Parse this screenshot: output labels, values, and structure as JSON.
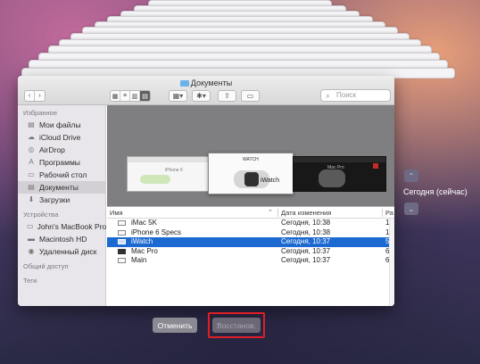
{
  "window": {
    "title": "Документы",
    "search_placeholder": "Поиск"
  },
  "toolbar": {
    "back": "‹",
    "forward": "›",
    "view_modes": [
      "▦",
      "≡",
      "▥",
      "▤"
    ],
    "group_menu": "▦▾",
    "action_menu": "✱▾",
    "share": "⇪",
    "tag": "▭"
  },
  "sidebar": {
    "favorites_header": "Избранное",
    "favorites": [
      {
        "icon": "all-files-icon",
        "glyph": "▤",
        "label": "Мои файлы"
      },
      {
        "icon": "cloud-icon",
        "glyph": "☁",
        "label": "iCloud Drive"
      },
      {
        "icon": "airdrop-icon",
        "glyph": "◎",
        "label": "AirDrop"
      },
      {
        "icon": "applications-icon",
        "glyph": "A",
        "label": "Программы"
      },
      {
        "icon": "desktop-icon",
        "glyph": "▭",
        "label": "Рабочий стол"
      },
      {
        "icon": "documents-icon",
        "glyph": "▤",
        "label": "Документы"
      },
      {
        "icon": "downloads-icon",
        "glyph": "⬇",
        "label": "Загрузки"
      }
    ],
    "devices_header": "Устройства",
    "devices": [
      {
        "icon": "laptop-icon",
        "glyph": "▭",
        "label": "John's MacBook Pro"
      },
      {
        "icon": "disk-icon",
        "glyph": "▬",
        "label": "Macintosh HD"
      },
      {
        "icon": "remote-disk-icon",
        "glyph": "◉",
        "label": "Удаленный диск"
      }
    ],
    "shared_header": "Общий доступ",
    "tags_header": "Теги"
  },
  "preview": {
    "thumb_a_title": "iPhone 6",
    "thumb_b_title": "iWatch",
    "thumb_b_heading": "WATCH",
    "thumb_c_title": "Mac Pro"
  },
  "list": {
    "columns": {
      "name": "Имя",
      "date": "Дата изменения",
      "size": "Ра"
    },
    "rows": [
      {
        "name": "iMac 5K",
        "date": "Сегодня, 10:38",
        "size": "1,"
      },
      {
        "name": "iPhone 6 Specs",
        "date": "Сегодня, 10:38",
        "size": "1,1"
      },
      {
        "name": "iWatch",
        "date": "Сегодня, 10:37",
        "size": "537"
      },
      {
        "name": "Mac Pro",
        "date": "Сегодня, 10:37",
        "size": "664"
      },
      {
        "name": "Main",
        "date": "Сегодня, 10:37",
        "size": "65"
      }
    ],
    "selected_index": 2
  },
  "timeline": {
    "up": "⌃",
    "down": "⌄",
    "current_label": "Сегодня (сейчас)"
  },
  "actions": {
    "cancel": "Отменить",
    "restore": "Восстанов."
  },
  "colors": {
    "selection": "#1c6ad1",
    "highlight_frame": "#e01e25"
  }
}
